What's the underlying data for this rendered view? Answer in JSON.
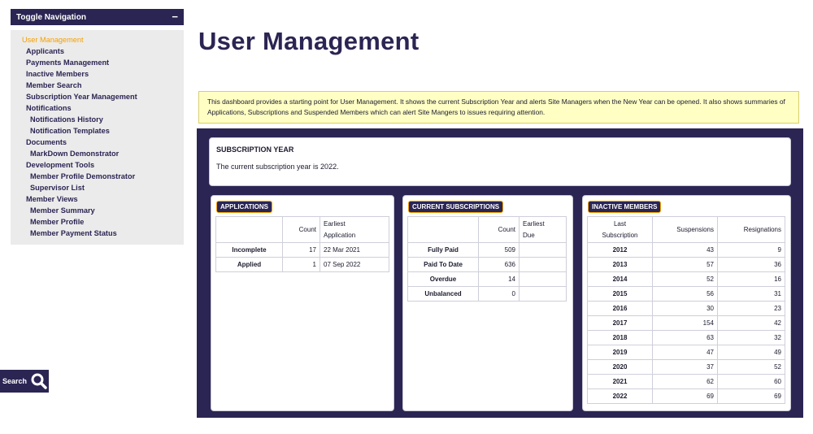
{
  "sidebar": {
    "toggle_label": "Toggle Navigation",
    "toggle_icon": "−",
    "items": [
      {
        "label": "User Management"
      },
      {
        "label": "Applicants"
      },
      {
        "label": "Payments Management"
      },
      {
        "label": "Inactive Members"
      },
      {
        "label": "Member Search"
      },
      {
        "label": "Subscription Year Management"
      },
      {
        "label": "Notifications"
      },
      {
        "label": "Notifications History"
      },
      {
        "label": "Notification Templates"
      },
      {
        "label": "Documents"
      },
      {
        "label": "MarkDown Demonstrator"
      },
      {
        "label": "Development Tools"
      },
      {
        "label": "Member Profile Demonstrator"
      },
      {
        "label": "Supervisor List"
      },
      {
        "label": "Member Views"
      },
      {
        "label": "Member Summary"
      },
      {
        "label": "Member Profile"
      },
      {
        "label": "Member Payment Status"
      }
    ],
    "search_label": "Search"
  },
  "page": {
    "title": "User Management",
    "intro": "This dashboard provides a starting point for User Management.  It shows the current Subscription Year and alerts Site Managers when the New Year can be opened.  It also shows summaries of Applications, Subscriptions and Suspended Members which can alert Site Mangers to issues requiring attention."
  },
  "subscription_year": {
    "heading": "SUBSCRIPTION YEAR",
    "text": "The current subscription year is 2022."
  },
  "applications": {
    "badge": "APPLICATIONS",
    "col_count": "Count",
    "col_earliest_1": "Earliest",
    "col_earliest_2": "Application",
    "rows": [
      {
        "label": "Incomplete",
        "count": "17",
        "date": "22 Mar 2021"
      },
      {
        "label": "Applied",
        "count": "1",
        "date": "07 Sep 2022"
      }
    ]
  },
  "subscriptions": {
    "badge": "CURRENT SUBSCRIPTIONS",
    "col_count": "Count",
    "col_earliest_1": "Earliest",
    "col_earliest_2": "Due",
    "rows": [
      {
        "label": "Fully Paid",
        "count": "509",
        "due": ""
      },
      {
        "label": "Paid To Date",
        "count": "636",
        "due": ""
      },
      {
        "label": "Overdue",
        "count": "14",
        "due": ""
      },
      {
        "label": "Unbalanced",
        "count": "0",
        "due": ""
      }
    ]
  },
  "inactive": {
    "badge": "INACTIVE MEMBERS",
    "col_last_1": "Last",
    "col_last_2": "Subscription",
    "col_suspensions": "Suspensions",
    "col_resignations": "Resignations",
    "rows": [
      {
        "year": "2012",
        "suspensions": "43",
        "resignations": "9"
      },
      {
        "year": "2013",
        "suspensions": "57",
        "resignations": "36"
      },
      {
        "year": "2014",
        "suspensions": "52",
        "resignations": "16"
      },
      {
        "year": "2015",
        "suspensions": "56",
        "resignations": "31"
      },
      {
        "year": "2016",
        "suspensions": "30",
        "resignations": "23"
      },
      {
        "year": "2017",
        "suspensions": "154",
        "resignations": "42"
      },
      {
        "year": "2018",
        "suspensions": "63",
        "resignations": "32"
      },
      {
        "year": "2019",
        "suspensions": "47",
        "resignations": "49"
      },
      {
        "year": "2020",
        "suspensions": "37",
        "resignations": "52"
      },
      {
        "year": "2021",
        "suspensions": "62",
        "resignations": "60"
      },
      {
        "year": "2022",
        "suspensions": "69",
        "resignations": "69"
      }
    ]
  },
  "colors": {
    "brand": "#2b2553",
    "accent": "#f5a000",
    "notice_bg": "#ffffc4"
  }
}
